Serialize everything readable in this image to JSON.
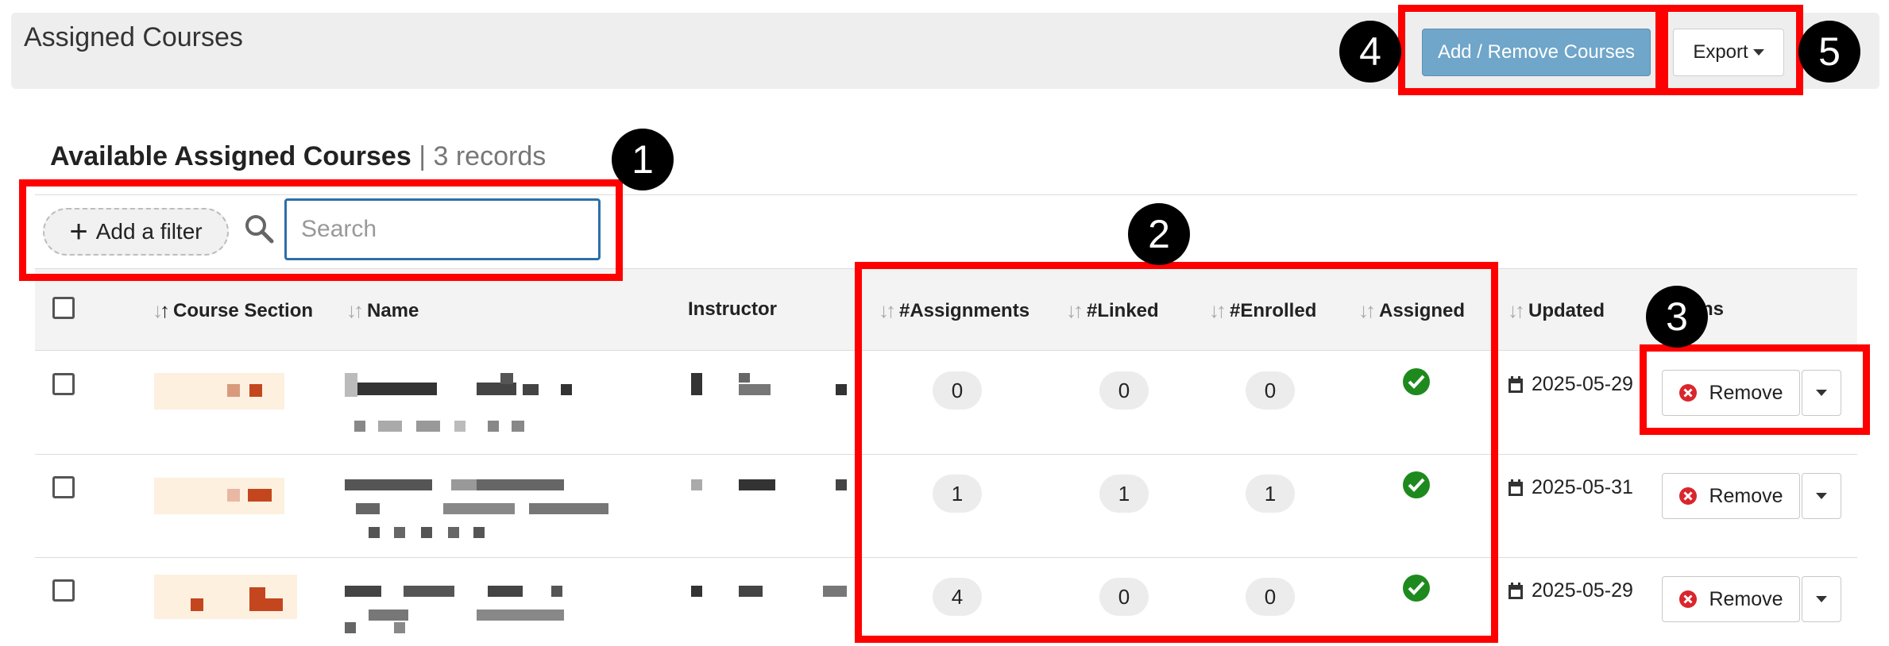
{
  "header": {
    "title": "Assigned Courses",
    "add_remove_label": "Add / Remove Courses",
    "export_label": "Export"
  },
  "section": {
    "title": "Available Assigned Courses",
    "separator": "|",
    "records": "3 records"
  },
  "toolbar": {
    "add_filter_label": "Add a filter",
    "search_placeholder": "Search",
    "search_value": ""
  },
  "columns": {
    "course_section": "Course Section",
    "name": "Name",
    "instructor": "Instructor",
    "assignments": "#Assignments",
    "linked": "#Linked",
    "enrolled": "#Enrolled",
    "assigned": "Assigned",
    "updated": "Updated",
    "actions": "ns"
  },
  "rows": [
    {
      "assignments": "0",
      "linked": "0",
      "enrolled": "0",
      "assigned": true,
      "updated": "2025-05-29",
      "action_label": "Remove"
    },
    {
      "assignments": "1",
      "linked": "1",
      "enrolled": "1",
      "assigned": true,
      "updated": "2025-05-31",
      "action_label": "Remove"
    },
    {
      "assignments": "4",
      "linked": "0",
      "enrolled": "0",
      "assigned": true,
      "updated": "2025-05-29",
      "action_label": "Remove"
    }
  ],
  "annotations": {
    "n1": "1",
    "n2": "2",
    "n3": "3",
    "n4": "4",
    "n5": "5"
  },
  "colors": {
    "primary_button": "#6fa6c9",
    "annotation": "#ff0000",
    "assigned_check": "#1e8a1e",
    "remove_icon": "#d9262c"
  },
  "icons": {
    "filter": "plus-icon",
    "search": "search-icon",
    "sort": "sort-arrows-icon",
    "assigned": "check-circle-icon",
    "date": "calendar-icon",
    "remove": "x-circle-icon",
    "dropdown": "caret-down-icon"
  }
}
